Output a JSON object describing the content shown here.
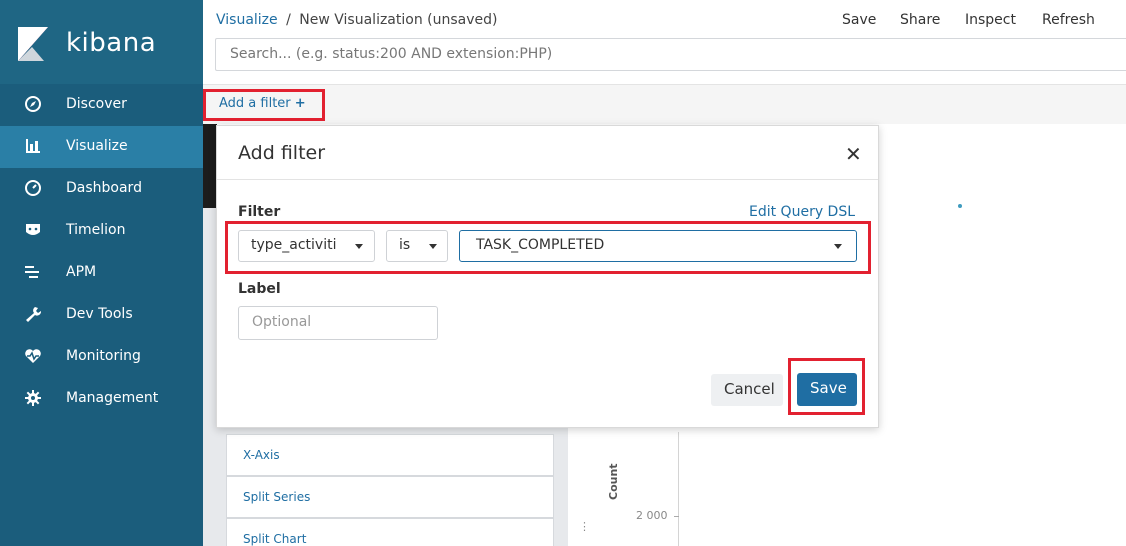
{
  "sidebar": {
    "logo_text": "kibana",
    "items": [
      {
        "label": "Discover",
        "icon": "compass-icon"
      },
      {
        "label": "Visualize",
        "icon": "bar-chart-icon",
        "active": true
      },
      {
        "label": "Dashboard",
        "icon": "dashboard-icon"
      },
      {
        "label": "Timelion",
        "icon": "timelion-icon"
      },
      {
        "label": "APM",
        "icon": "apm-icon"
      },
      {
        "label": "Dev Tools",
        "icon": "wrench-icon"
      },
      {
        "label": "Monitoring",
        "icon": "heartbeat-icon"
      },
      {
        "label": "Management",
        "icon": "gear-icon"
      }
    ]
  },
  "header": {
    "breadcrumb_link": "Visualize",
    "breadcrumb_separator": "/",
    "breadcrumb_current": "New Visualization (unsaved)",
    "top_links": [
      "Save",
      "Share",
      "Inspect",
      "Refresh"
    ],
    "search_placeholder": "Search... (e.g. status:200 AND extension:PHP)"
  },
  "filter_bar": {
    "add_filter_label": "Add a filter",
    "add_filter_icon": "plus-icon"
  },
  "modal": {
    "title": "Add filter",
    "close_icon": "close-icon",
    "filter_label": "Filter",
    "edit_dsl_label": "Edit Query DSL",
    "field_value": "type_activiti",
    "operator_value": "is",
    "value_value": "TASK_COMPLETED",
    "label_label": "Label",
    "label_placeholder": "Optional",
    "cancel_label": "Cancel",
    "save_label": "Save"
  },
  "buckets": [
    "X-Axis",
    "Split Series",
    "Split Chart"
  ],
  "chart": {
    "y_title": "Count",
    "tick": "2 000"
  },
  "colors": {
    "sidebar": "#1b5d7c",
    "sidebar_active": "#2a7fa6",
    "link": "#1f6ea3",
    "highlight": "#e22130"
  }
}
